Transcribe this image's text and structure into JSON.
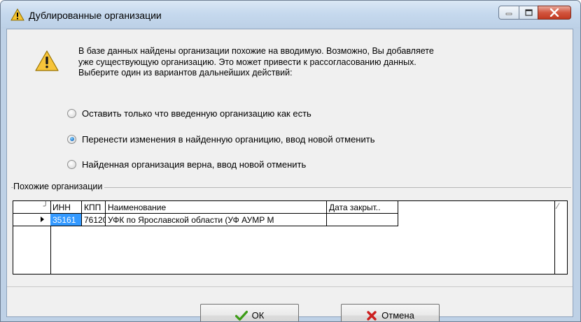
{
  "window": {
    "title": "Дублированные организации",
    "icon": "warning-icon",
    "controls": [
      "minimize-icon",
      "maximize-icon",
      "close-icon"
    ]
  },
  "message": {
    "icon": "warning-icon",
    "lines": [
      "В базе данных найдены организации похожие на вводимую. Возможно, Вы добавляете",
      "уже существующую организацию. Это может привести к рассогласованию данных.",
      "Выберите один из вариантов дальнейших действий:"
    ]
  },
  "options": [
    {
      "label": "Оставить только что введенную организацию как есть",
      "checked": false
    },
    {
      "label": "Перенести изменения в найденную органицию, ввод новой отменить",
      "checked": true
    },
    {
      "label": "Найденная организация верна, ввод новой отменить",
      "checked": false
    }
  ],
  "similar": {
    "group_label": "Похожие организации",
    "columns": [
      "ИНН",
      "КПП",
      "Наименование",
      "Дата закрыт.."
    ],
    "rows": [
      [
        "35161",
        "76120",
        "УФК по Ярославской области (УФ АУМР М",
        ""
      ]
    ]
  },
  "buttons": {
    "ok_label": "ОК",
    "cancel_label": "Отмена"
  },
  "colors": {
    "selection": "#3399ff",
    "ok_check": "#3c9c16",
    "cancel_x": "#cc1f1f",
    "warning_fill": "#f7c43a"
  }
}
